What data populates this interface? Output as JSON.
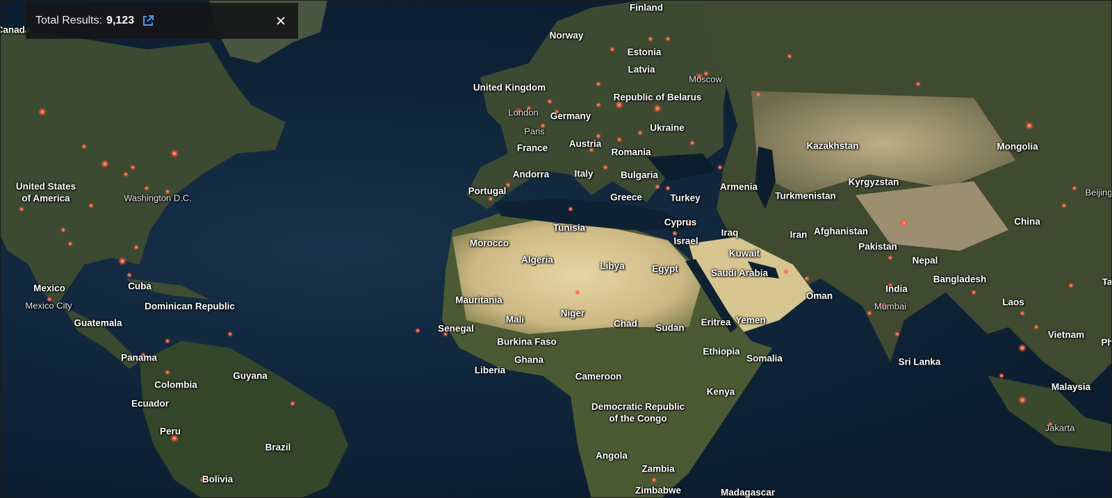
{
  "results": {
    "label": "Total Results:",
    "count": "9,123"
  },
  "colors": {
    "ocean": "#0e2236",
    "land_green": "#34452e",
    "desert": "#d9c99a",
    "hotspot": "#ff5a3c"
  },
  "icons": {
    "open": "external-link-icon",
    "close": "close-icon"
  },
  "places": [
    {
      "name": "Canada",
      "kind": "country"
    },
    {
      "name": "Finland",
      "kind": "country"
    },
    {
      "name": "Norway",
      "kind": "country"
    },
    {
      "name": "Estonia",
      "kind": "country"
    },
    {
      "name": "Latvia",
      "kind": "country"
    },
    {
      "name": "Moscow",
      "kind": "city"
    },
    {
      "name": "United Kingdom",
      "kind": "country"
    },
    {
      "name": "Republic of Belarus",
      "kind": "country"
    },
    {
      "name": "London",
      "kind": "city"
    },
    {
      "name": "Germany",
      "kind": "country"
    },
    {
      "name": "Paris",
      "kind": "city"
    },
    {
      "name": "Ukraine",
      "kind": "country"
    },
    {
      "name": "Kazakhstan",
      "kind": "country"
    },
    {
      "name": "Mongolia",
      "kind": "country"
    },
    {
      "name": "France",
      "kind": "country"
    },
    {
      "name": "Austria",
      "kind": "country"
    },
    {
      "name": "Romania",
      "kind": "country"
    },
    {
      "name": "Andorra",
      "kind": "country"
    },
    {
      "name": "Italy",
      "kind": "country"
    },
    {
      "name": "Bulgaria",
      "kind": "country"
    },
    {
      "name": "Armenia",
      "kind": "country"
    },
    {
      "name": "Kyrgyzstan",
      "kind": "country"
    },
    {
      "name": "Beijing",
      "kind": "city"
    },
    {
      "name": "United States\nof America",
      "kind": "country"
    },
    {
      "name": "Washington D.C.",
      "kind": "city"
    },
    {
      "name": "Portugal",
      "kind": "country"
    },
    {
      "name": "Greece",
      "kind": "country"
    },
    {
      "name": "Turkey",
      "kind": "country"
    },
    {
      "name": "Turkmenistan",
      "kind": "country"
    },
    {
      "name": "Tunisia",
      "kind": "country"
    },
    {
      "name": "Cyprus",
      "kind": "country"
    },
    {
      "name": "Iraq",
      "kind": "country"
    },
    {
      "name": "Iran",
      "kind": "country"
    },
    {
      "name": "Afghanistan",
      "kind": "country"
    },
    {
      "name": "China",
      "kind": "country"
    },
    {
      "name": "Morocco",
      "kind": "country"
    },
    {
      "name": "Israel",
      "kind": "country"
    },
    {
      "name": "Pakistan",
      "kind": "country"
    },
    {
      "name": "Kuwait",
      "kind": "country"
    },
    {
      "name": "Algeria",
      "kind": "country"
    },
    {
      "name": "Libya",
      "kind": "country"
    },
    {
      "name": "Egypt",
      "kind": "country"
    },
    {
      "name": "Saudi Arabia",
      "kind": "country"
    },
    {
      "name": "Nepal",
      "kind": "country"
    },
    {
      "name": "Mexico",
      "kind": "country"
    },
    {
      "name": "Cuba",
      "kind": "country"
    },
    {
      "name": "Bangladesh",
      "kind": "country"
    },
    {
      "name": "India",
      "kind": "country"
    },
    {
      "name": "Oman",
      "kind": "country"
    },
    {
      "name": "Mexico City",
      "kind": "city"
    },
    {
      "name": "Dominican Republic",
      "kind": "country"
    },
    {
      "name": "Mauritania",
      "kind": "country"
    },
    {
      "name": "Mumbai",
      "kind": "city"
    },
    {
      "name": "Laos",
      "kind": "country"
    },
    {
      "name": "Niger",
      "kind": "country"
    },
    {
      "name": "Mali",
      "kind": "country"
    },
    {
      "name": "Chad",
      "kind": "country"
    },
    {
      "name": "Sudan",
      "kind": "country"
    },
    {
      "name": "Eritrea",
      "kind": "country"
    },
    {
      "name": "Yemen",
      "kind": "country"
    },
    {
      "name": "Guatemala",
      "kind": "country"
    },
    {
      "name": "Senegal",
      "kind": "country"
    },
    {
      "name": "Vietnam",
      "kind": "country"
    },
    {
      "name": "Burkina Faso",
      "kind": "country"
    },
    {
      "name": "Ethiopia",
      "kind": "country"
    },
    {
      "name": "Panama",
      "kind": "country"
    },
    {
      "name": "Ghana",
      "kind": "country"
    },
    {
      "name": "Somalia",
      "kind": "country"
    },
    {
      "name": "Sri Lanka",
      "kind": "country"
    },
    {
      "name": "Liberia",
      "kind": "country"
    },
    {
      "name": "Guyana",
      "kind": "country"
    },
    {
      "name": "Cameroon",
      "kind": "country"
    },
    {
      "name": "Colombia",
      "kind": "country"
    },
    {
      "name": "Malaysia",
      "kind": "country"
    },
    {
      "name": "Kenya",
      "kind": "country"
    },
    {
      "name": "Ecuador",
      "kind": "country"
    },
    {
      "name": "Democratic Republic\nof the Congo",
      "kind": "country"
    },
    {
      "name": "Peru",
      "kind": "country"
    },
    {
      "name": "Jakarta",
      "kind": "city"
    },
    {
      "name": "Brazil",
      "kind": "country"
    },
    {
      "name": "Angola",
      "kind": "country"
    },
    {
      "name": "Zambia",
      "kind": "country"
    },
    {
      "name": "Bolivia",
      "kind": "country"
    },
    {
      "name": "Zimbabwe",
      "kind": "country"
    },
    {
      "name": "Madagascar",
      "kind": "country"
    },
    {
      "name": "Ta",
      "kind": "country"
    },
    {
      "name": "Ph",
      "kind": "country"
    }
  ]
}
